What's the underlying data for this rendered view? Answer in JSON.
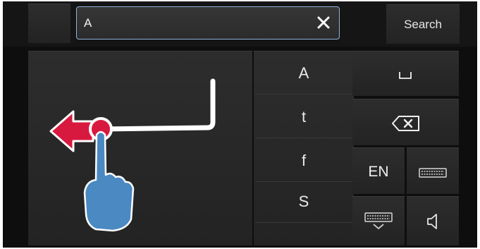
{
  "search": {
    "query": "A",
    "button_label": "Search"
  },
  "candidates": [
    "A",
    "t",
    "f",
    "S"
  ],
  "keys": {
    "language_label": "EN"
  },
  "colors": {
    "arrow": "#d8193f",
    "hand": "#4a89c2",
    "field_border": "#8fb3d9"
  },
  "icons": [
    "close-icon",
    "space-icon",
    "backspace-icon",
    "keyboard-icon",
    "hide-keyboard-icon",
    "volume-icon",
    "swipe-arrow-icon",
    "hand-icon"
  ]
}
